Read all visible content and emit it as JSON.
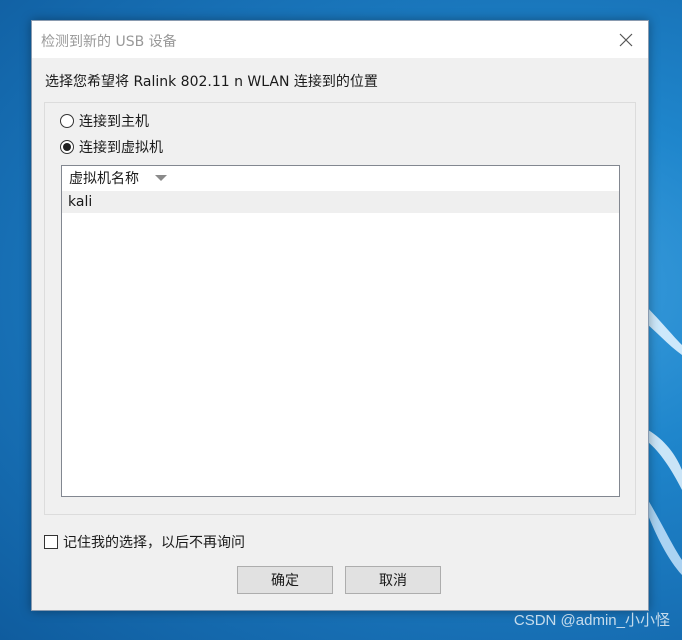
{
  "dialog": {
    "title": "检测到新的 USB 设备",
    "prompt": "选择您希望将 Ralink 802.11 n WLAN 连接到的位置",
    "options": [
      {
        "label": "连接到主机",
        "checked": false
      },
      {
        "label": "连接到虚拟机",
        "checked": true
      }
    ],
    "list": {
      "header": "虚拟机名称",
      "rows": [
        "kali"
      ]
    },
    "remember_label": "记住我的选择，以后不再询问",
    "ok_label": "确定",
    "cancel_label": "取消"
  },
  "watermark": "CSDN @admin_小小怪",
  "icons": {
    "close": "close-icon",
    "sort": "sort-down-icon"
  },
  "colors": {
    "desktop": "#1c78bd",
    "dialog_bg": "#f0f0f0",
    "title_text": "#999999"
  }
}
